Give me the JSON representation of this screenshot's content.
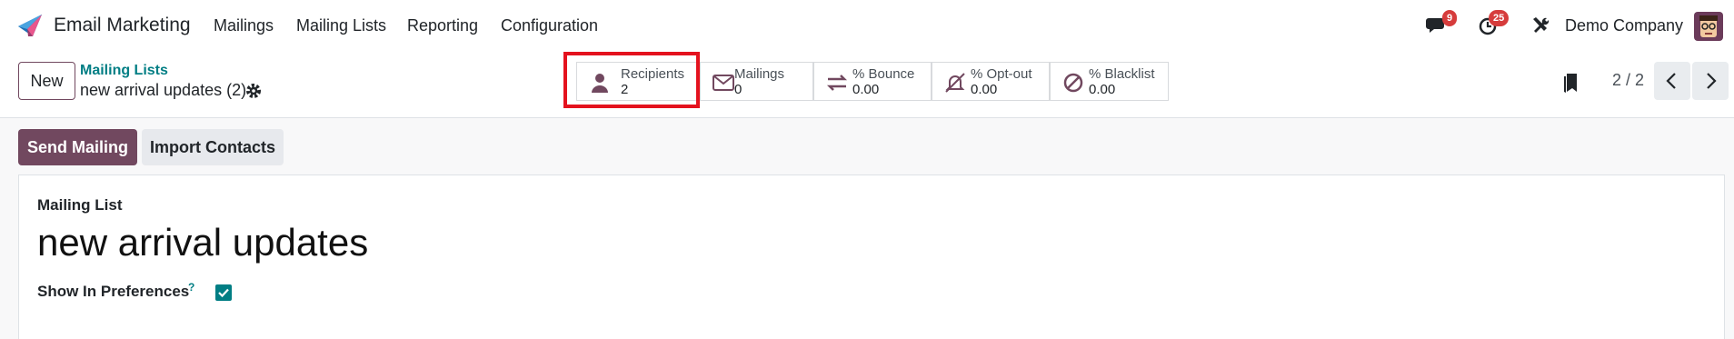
{
  "navbar": {
    "app_name": "Email Marketing",
    "menu": [
      "Mailings",
      "Mailing Lists",
      "Reporting",
      "Configuration"
    ],
    "chat_count": "9",
    "activity_count": "25",
    "company": "Demo Company"
  },
  "control_panel": {
    "new_label": "New",
    "breadcrumb": "Mailing Lists",
    "record_title": "new arrival updates (2)",
    "stats": [
      {
        "label": "Recipients",
        "value": "2",
        "icon": "user-icon"
      },
      {
        "label": "Mailings",
        "value": "0",
        "icon": "envelope-icon"
      },
      {
        "label": "% Bounce",
        "value": "0.00",
        "icon": "exchange-arrows-icon"
      },
      {
        "label": "% Opt-out",
        "value": "0.00",
        "icon": "bell-slash-icon"
      },
      {
        "label": "% Blacklist",
        "value": "0.00",
        "icon": "ban-icon"
      }
    ],
    "pager": "2 / 2"
  },
  "actions": {
    "send_label": "Send Mailing",
    "import_label": "Import Contacts"
  },
  "form": {
    "caption": "Mailing List",
    "name": "new arrival updates",
    "pref_label": "Show In Preferences",
    "help": "?",
    "pref_checked": true
  },
  "colors": {
    "brand": "#71485f",
    "link": "#017e84",
    "badge": "#d63c3c",
    "highlight": "#e4121e"
  }
}
